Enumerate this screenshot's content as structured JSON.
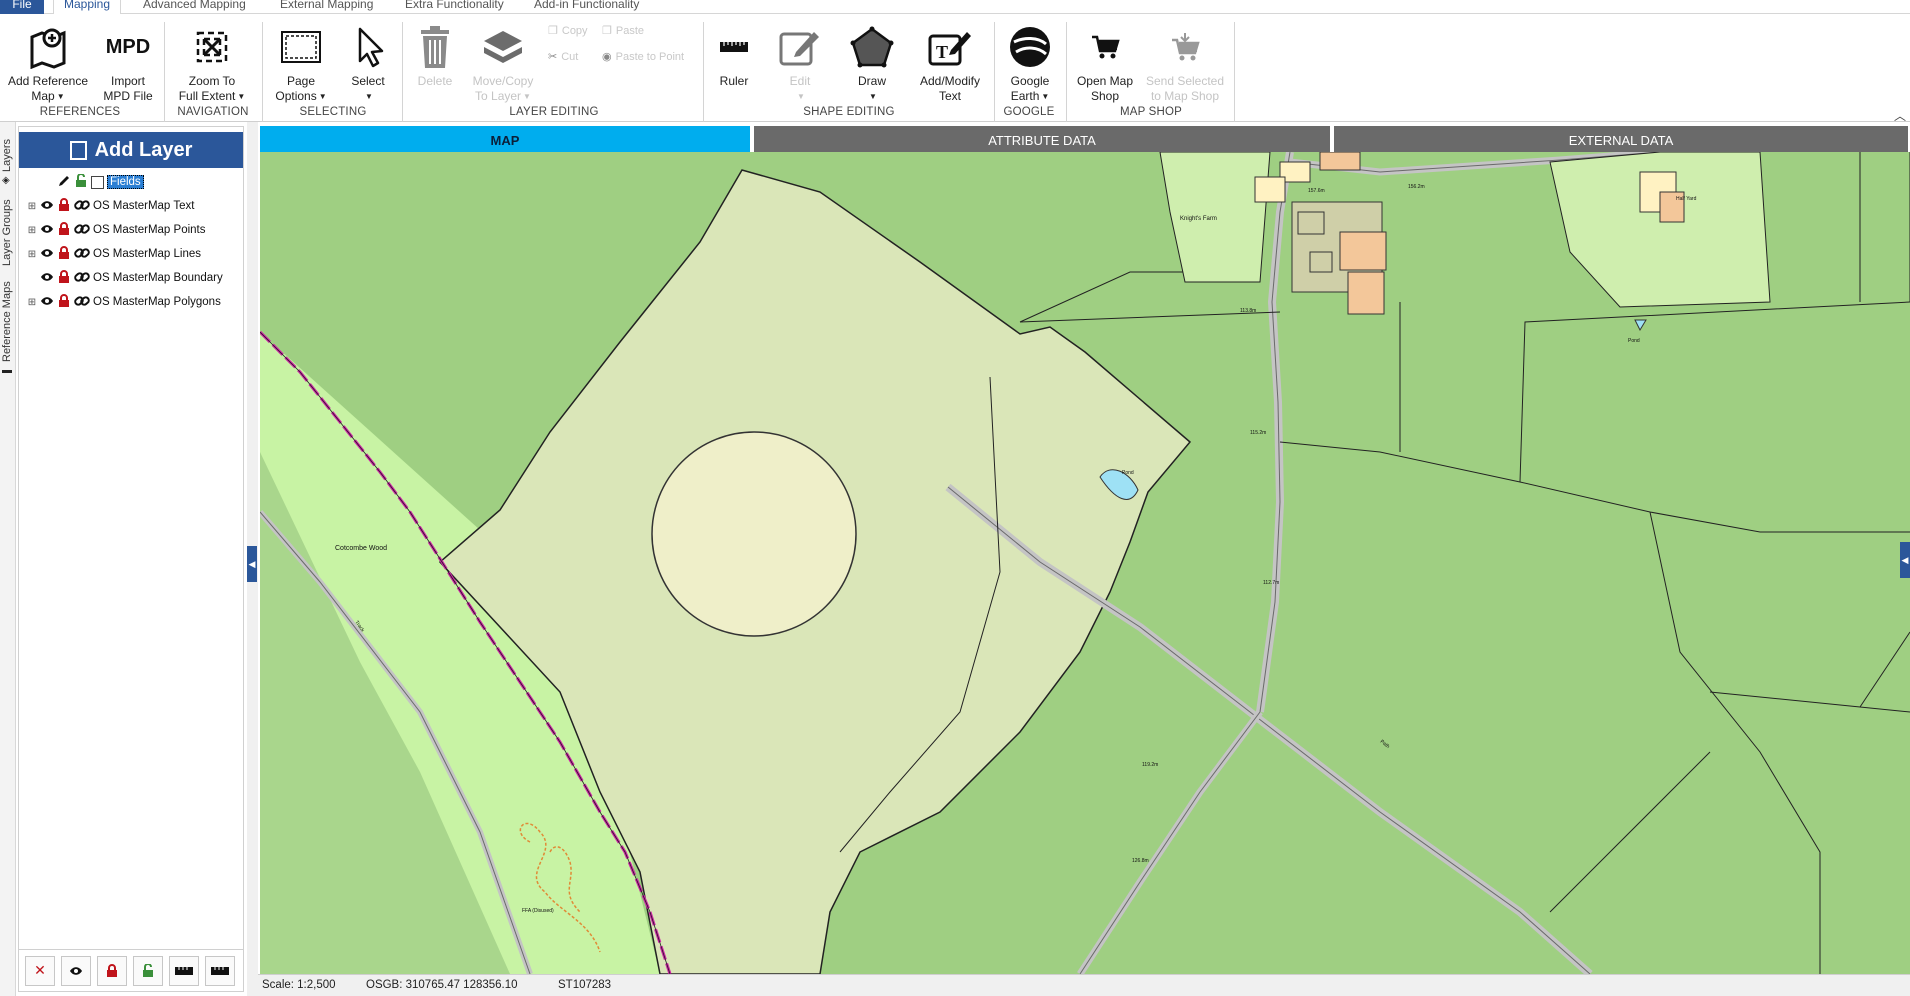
{
  "menu": {
    "file": "File",
    "tabs": [
      "Mapping",
      "Advanced Mapping",
      "External Mapping",
      "Extra Functionality",
      "Add-in Functionality"
    ]
  },
  "ribbon": {
    "add_reference_map": [
      "Add Reference",
      "Map"
    ],
    "import_mpd": [
      "Import",
      "MPD File"
    ],
    "mpd_glyph": "MPD",
    "zoom_full": [
      "Zoom To",
      "Full Extent"
    ],
    "page_options": [
      "Page",
      "Options"
    ],
    "select": "Select",
    "delete": "Delete",
    "move_copy": [
      "Move/Copy",
      "To Layer"
    ],
    "copy": "Copy",
    "paste": "Paste",
    "cut": "Cut",
    "paste_to_point": "Paste to Point",
    "ruler": "Ruler",
    "edit": "Edit",
    "draw": "Draw",
    "add_modify_text": [
      "Add/Modify",
      "Text"
    ],
    "google_earth": [
      "Google",
      "Earth"
    ],
    "open_map_shop": [
      "Open Map",
      "Shop"
    ],
    "send_selected": [
      "Send Selected",
      "to Map Shop"
    ],
    "groups": {
      "references": "REFERENCES",
      "navigation": "NAVIGATION",
      "selecting": "SELECTING",
      "layer_editing": "LAYER EDITING",
      "shape_editing": "SHAPE EDITING",
      "google": "GOOGLE",
      "map_shop": "MAP SHOP"
    }
  },
  "side_tabs": [
    "Layers",
    "Layer Groups",
    "Reference Maps"
  ],
  "layer_panel": {
    "add_layer": "Add Layer",
    "layers": [
      {
        "name": "Fields",
        "selected": true,
        "expandable": false
      },
      {
        "name": "OS MasterMap Text",
        "selected": false,
        "expandable": true
      },
      {
        "name": "OS MasterMap Points",
        "selected": false,
        "expandable": true
      },
      {
        "name": "OS MasterMap Lines",
        "selected": false,
        "expandable": true
      },
      {
        "name": "OS MasterMap Boundary",
        "selected": false,
        "expandable": false
      },
      {
        "name": "OS MasterMap Polygons",
        "selected": false,
        "expandable": true
      }
    ]
  },
  "map_tabs": [
    "MAP",
    "ATTRIBUTE DATA",
    "EXTERNAL DATA"
  ],
  "map_labels": {
    "wood": "Cotcombe Wood",
    "farm": "Knight's Farm",
    "pond1": "Pond",
    "pond2": "Pond",
    "spot1": "113.8m",
    "spot2": "112.7m",
    "spot3": "115.2m",
    "spot4": "119.2m",
    "spot5": "126.8m",
    "spot6": "157.6m",
    "spot7": "156.2m",
    "halfyard": "Half Yard",
    "track": "Track",
    "path": "Path",
    "ffa": "FFA (Disused)"
  },
  "status": {
    "scale": "Scale: 1:2,500",
    "coords": "OSGB: 310765.47  128356.10",
    "gridref": "ST107283"
  },
  "colors": {
    "accent": "#2b579a",
    "map_tab_active": "#00adee",
    "field_selected": "#dbe6b8",
    "grass": "#9acb7c",
    "woodland": "#c9f3a6",
    "road": "#bdbdbd",
    "boundary_magenta": "#d01fa8"
  }
}
